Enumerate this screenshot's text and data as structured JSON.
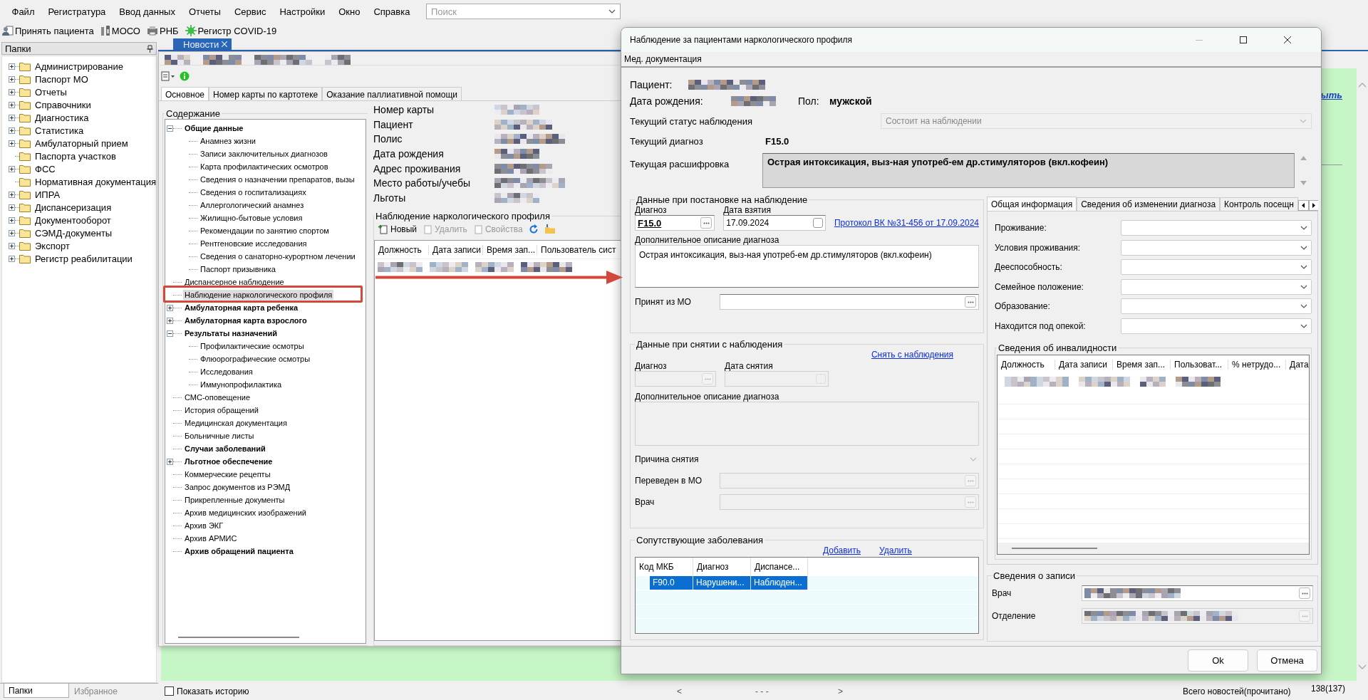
{
  "menu": [
    "Файл",
    "Регистратура",
    "Ввод данных",
    "Отчеты",
    "Сервис",
    "Настройки",
    "Окно",
    "Справка"
  ],
  "search": {
    "placeholder": "Поиск"
  },
  "toolbar": [
    {
      "kind": "patient",
      "label": "Принять пациента"
    },
    {
      "kind": "moso",
      "label": "МОСО"
    },
    {
      "kind": "rnb",
      "label": "РНБ"
    },
    {
      "kind": "covid",
      "label": "Регистр COVID-19"
    }
  ],
  "folders": {
    "title": "Папки",
    "items": [
      {
        "label": "Администрирование",
        "expanded": false
      },
      {
        "label": "Паспорт МО",
        "expanded": false
      },
      {
        "label": "Отчеты",
        "expanded": false
      },
      {
        "label": "Справочники",
        "expanded": false
      },
      {
        "label": "Диагностика",
        "expanded": false
      },
      {
        "label": "Статистика",
        "expanded": false
      },
      {
        "label": "Амбулаторный прием",
        "expanded": false
      },
      {
        "label": "Паспорта участков"
      },
      {
        "label": "ФСС",
        "expanded": false
      },
      {
        "label": "Нормативная документация"
      },
      {
        "label": "ИПРА",
        "expanded": false
      },
      {
        "label": "Диспансеризация",
        "expanded": false
      },
      {
        "label": "Документооборот",
        "expanded": false
      },
      {
        "label": "СЭМД-документы",
        "expanded": false
      },
      {
        "label": "Экспорт",
        "expanded": false
      },
      {
        "label": "Регистр реабилитации",
        "expanded": false
      }
    ]
  },
  "folder_tabs": [
    {
      "label": "Папки",
      "selected": true
    },
    {
      "label": "Избранное",
      "selected": false
    }
  ],
  "doc_tabs": [
    {
      "label": "Новости",
      "selected": true
    }
  ],
  "news": {
    "link_fragment": "ыть"
  },
  "patient_card": {
    "tabs": [
      {
        "label": "Основное",
        "selected": true
      },
      {
        "label": "Номер карты по картотеке",
        "selected": false
      },
      {
        "label": "Оказание паллиативной помощи",
        "selected": false
      }
    ],
    "contents_title": "Содержание",
    "tree": [
      {
        "label": "Общие данные",
        "bold": true,
        "expanded": true,
        "selected": false,
        "children": [
          {
            "label": "Анамнез жизни",
            "selected": false
          },
          {
            "label": "Записи заключительных диагнозов",
            "selected": false
          },
          {
            "label": "Карта профилактических осмотров",
            "selected": false
          },
          {
            "label": "Сведения о назначении препаратов, вызы",
            "selected": false
          },
          {
            "label": "Сведения о госпитализациях",
            "selected": false
          },
          {
            "label": "Аллергологический анамнез",
            "selected": false
          },
          {
            "label": "Жилищно-бытовые условия",
            "selected": false
          },
          {
            "label": "Рекомендации по занятию спортом",
            "selected": false
          },
          {
            "label": "Рентгеновские исследования",
            "selected": false
          },
          {
            "label": "Сведения о санаторно-курортном лечении",
            "selected": false
          },
          {
            "label": "Паспорт призывника",
            "selected": false
          }
        ]
      },
      {
        "label": "Диспансерное наблюдение",
        "selected": false
      },
      {
        "label": "Наблюдение наркологического профиля",
        "selected": true
      },
      {
        "label": "Амбулаторная карта ребенка",
        "bold": true,
        "expanded": false,
        "selected": false
      },
      {
        "label": "Амбулаторная карта взрослого",
        "bold": true,
        "expanded": false,
        "selected": false
      },
      {
        "label": "Результаты назначений",
        "bold": true,
        "expanded": true,
        "selected": false,
        "children": [
          {
            "label": "Профилактические осмотры",
            "selected": false
          },
          {
            "label": "Флюорографические осмотры",
            "selected": false
          },
          {
            "label": "Исследования",
            "selected": false
          },
          {
            "label": "Иммунопрофилактика",
            "selected": false
          }
        ]
      },
      {
        "label": "СМС-оповещение",
        "selected": false
      },
      {
        "label": "История обращений",
        "selected": false
      },
      {
        "label": "Медицинская документация",
        "selected": false
      },
      {
        "label": "Больничные листы",
        "selected": false
      },
      {
        "label": "Случаи заболеваний",
        "bold": true,
        "selected": false
      },
      {
        "label": "Льготное обеспечение",
        "bold": true,
        "expanded": false,
        "selected": false
      },
      {
        "label": "Коммерческие рецепты",
        "selected": false
      },
      {
        "label": "Запрос документов из РЭМД",
        "selected": false
      },
      {
        "label": "Прикрепленные документы",
        "selected": false
      },
      {
        "label": "Архив медицинских изображений",
        "selected": false
      },
      {
        "label": "Архив ЭКГ",
        "selected": false
      },
      {
        "label": "Архив АРМИС",
        "selected": false
      },
      {
        "label": "Архив обращений пациента",
        "bold": true,
        "selected": false
      }
    ],
    "fields": [
      "Номер карты",
      "Пациент",
      "Полис",
      "Дата рождения",
      "Адрес проживания",
      "Место работы/учебы",
      "Льготы"
    ],
    "observation": {
      "title": "Наблюдение наркологического профиля",
      "actions": [
        {
          "label": "Новый",
          "disabled": false
        },
        {
          "label": "Удалить",
          "disabled": true
        },
        {
          "label": "Свойства",
          "disabled": true
        }
      ],
      "columns": [
        "Должность",
        "Дата записи",
        "Время зап...",
        "Пользователь сист"
      ]
    }
  },
  "dialog": {
    "title": "Наблюдение за пациентами наркологического профиля",
    "menu": [
      "Мед. документация"
    ],
    "header": {
      "patient_label": "Пациент:",
      "birth_label": "Дата рождения:",
      "sex_label": "Пол:",
      "sex_value": "мужской",
      "status_label": "Текущий статус наблюдения",
      "status_value": "Состоит на наблюдении",
      "diagnosis_label": "Текущий диагноз",
      "diagnosis_value": "F15.0",
      "decoding_label": "Текущая расшифровка",
      "decoding_value": "Острая интоксикация, выз-ная употреб-ем др.стимуляторов (вкл.кофеин)"
    },
    "registration": {
      "title": "Данные при постановке на наблюдение",
      "diagnosis_label": "Диагноз",
      "diagnosis_value": "F15.0",
      "date_label": "Дата взятия",
      "date_value": "17.09.2024",
      "protocol_link": "Протокол ВК №31-456 от 17.09.2024",
      "description_label": "Дополнительное описание диагноза",
      "description_value": "Острая интоксикация, выз-ная употреб-ем др.стимуляторов (вкл.кофеин)",
      "from_mo_label": "Принят из МО"
    },
    "deregistration": {
      "title": "Данные при снятии с наблюдения",
      "action_link": "Снять с наблюдения",
      "diagnosis_label": "Диагноз",
      "date_label": "Дата снятия",
      "description_label": "Дополнительное описание диагноза",
      "reason_label": "Причина снятия",
      "transferred_label": "Переведен в МО",
      "doctor_label": "Врач",
      "disabled": true
    },
    "comorbid": {
      "title": "Сопутствующие заболевания",
      "actions": [
        "Добавить",
        "Удалить"
      ],
      "columns": [
        "Код МКБ",
        "Диагноз",
        "Диспансе..."
      ],
      "rows": [
        {
          "cells": [
            "F90.0",
            "Нарушени...",
            "Наблюден..."
          ],
          "selected": true
        }
      ]
    },
    "tabs": [
      {
        "label": "Общая информация",
        "selected": true
      },
      {
        "label": "Сведения об изменении диагноза",
        "selected": false
      },
      {
        "label": "Контроль посещн",
        "selected": false
      }
    ],
    "general": [
      "Проживание:",
      "Условия проживания:",
      "Дееспособность:",
      "Семейное положение:",
      "Образование:",
      "Находится под опекой:"
    ],
    "disability": {
      "title": "Сведения об инвалидности",
      "columns": [
        "Должность",
        "Дата записи",
        "Время зап...",
        "Пользоват...",
        "% нетрудо...",
        "Дата"
      ]
    },
    "record": {
      "title": "Сведения о записи",
      "fields": [
        {
          "label": "Врач",
          "disabled": false
        },
        {
          "label": "Отделение",
          "disabled": true
        }
      ]
    },
    "buttons": [
      "Ok",
      "Отмена"
    ]
  },
  "status_bar": {
    "show_history": {
      "label": "Показать историю",
      "checked": false
    },
    "nav": [
      "<",
      "- - -",
      ">"
    ],
    "news_label": "Всего новостей(прочитано)",
    "news_count": "138(137)"
  }
}
